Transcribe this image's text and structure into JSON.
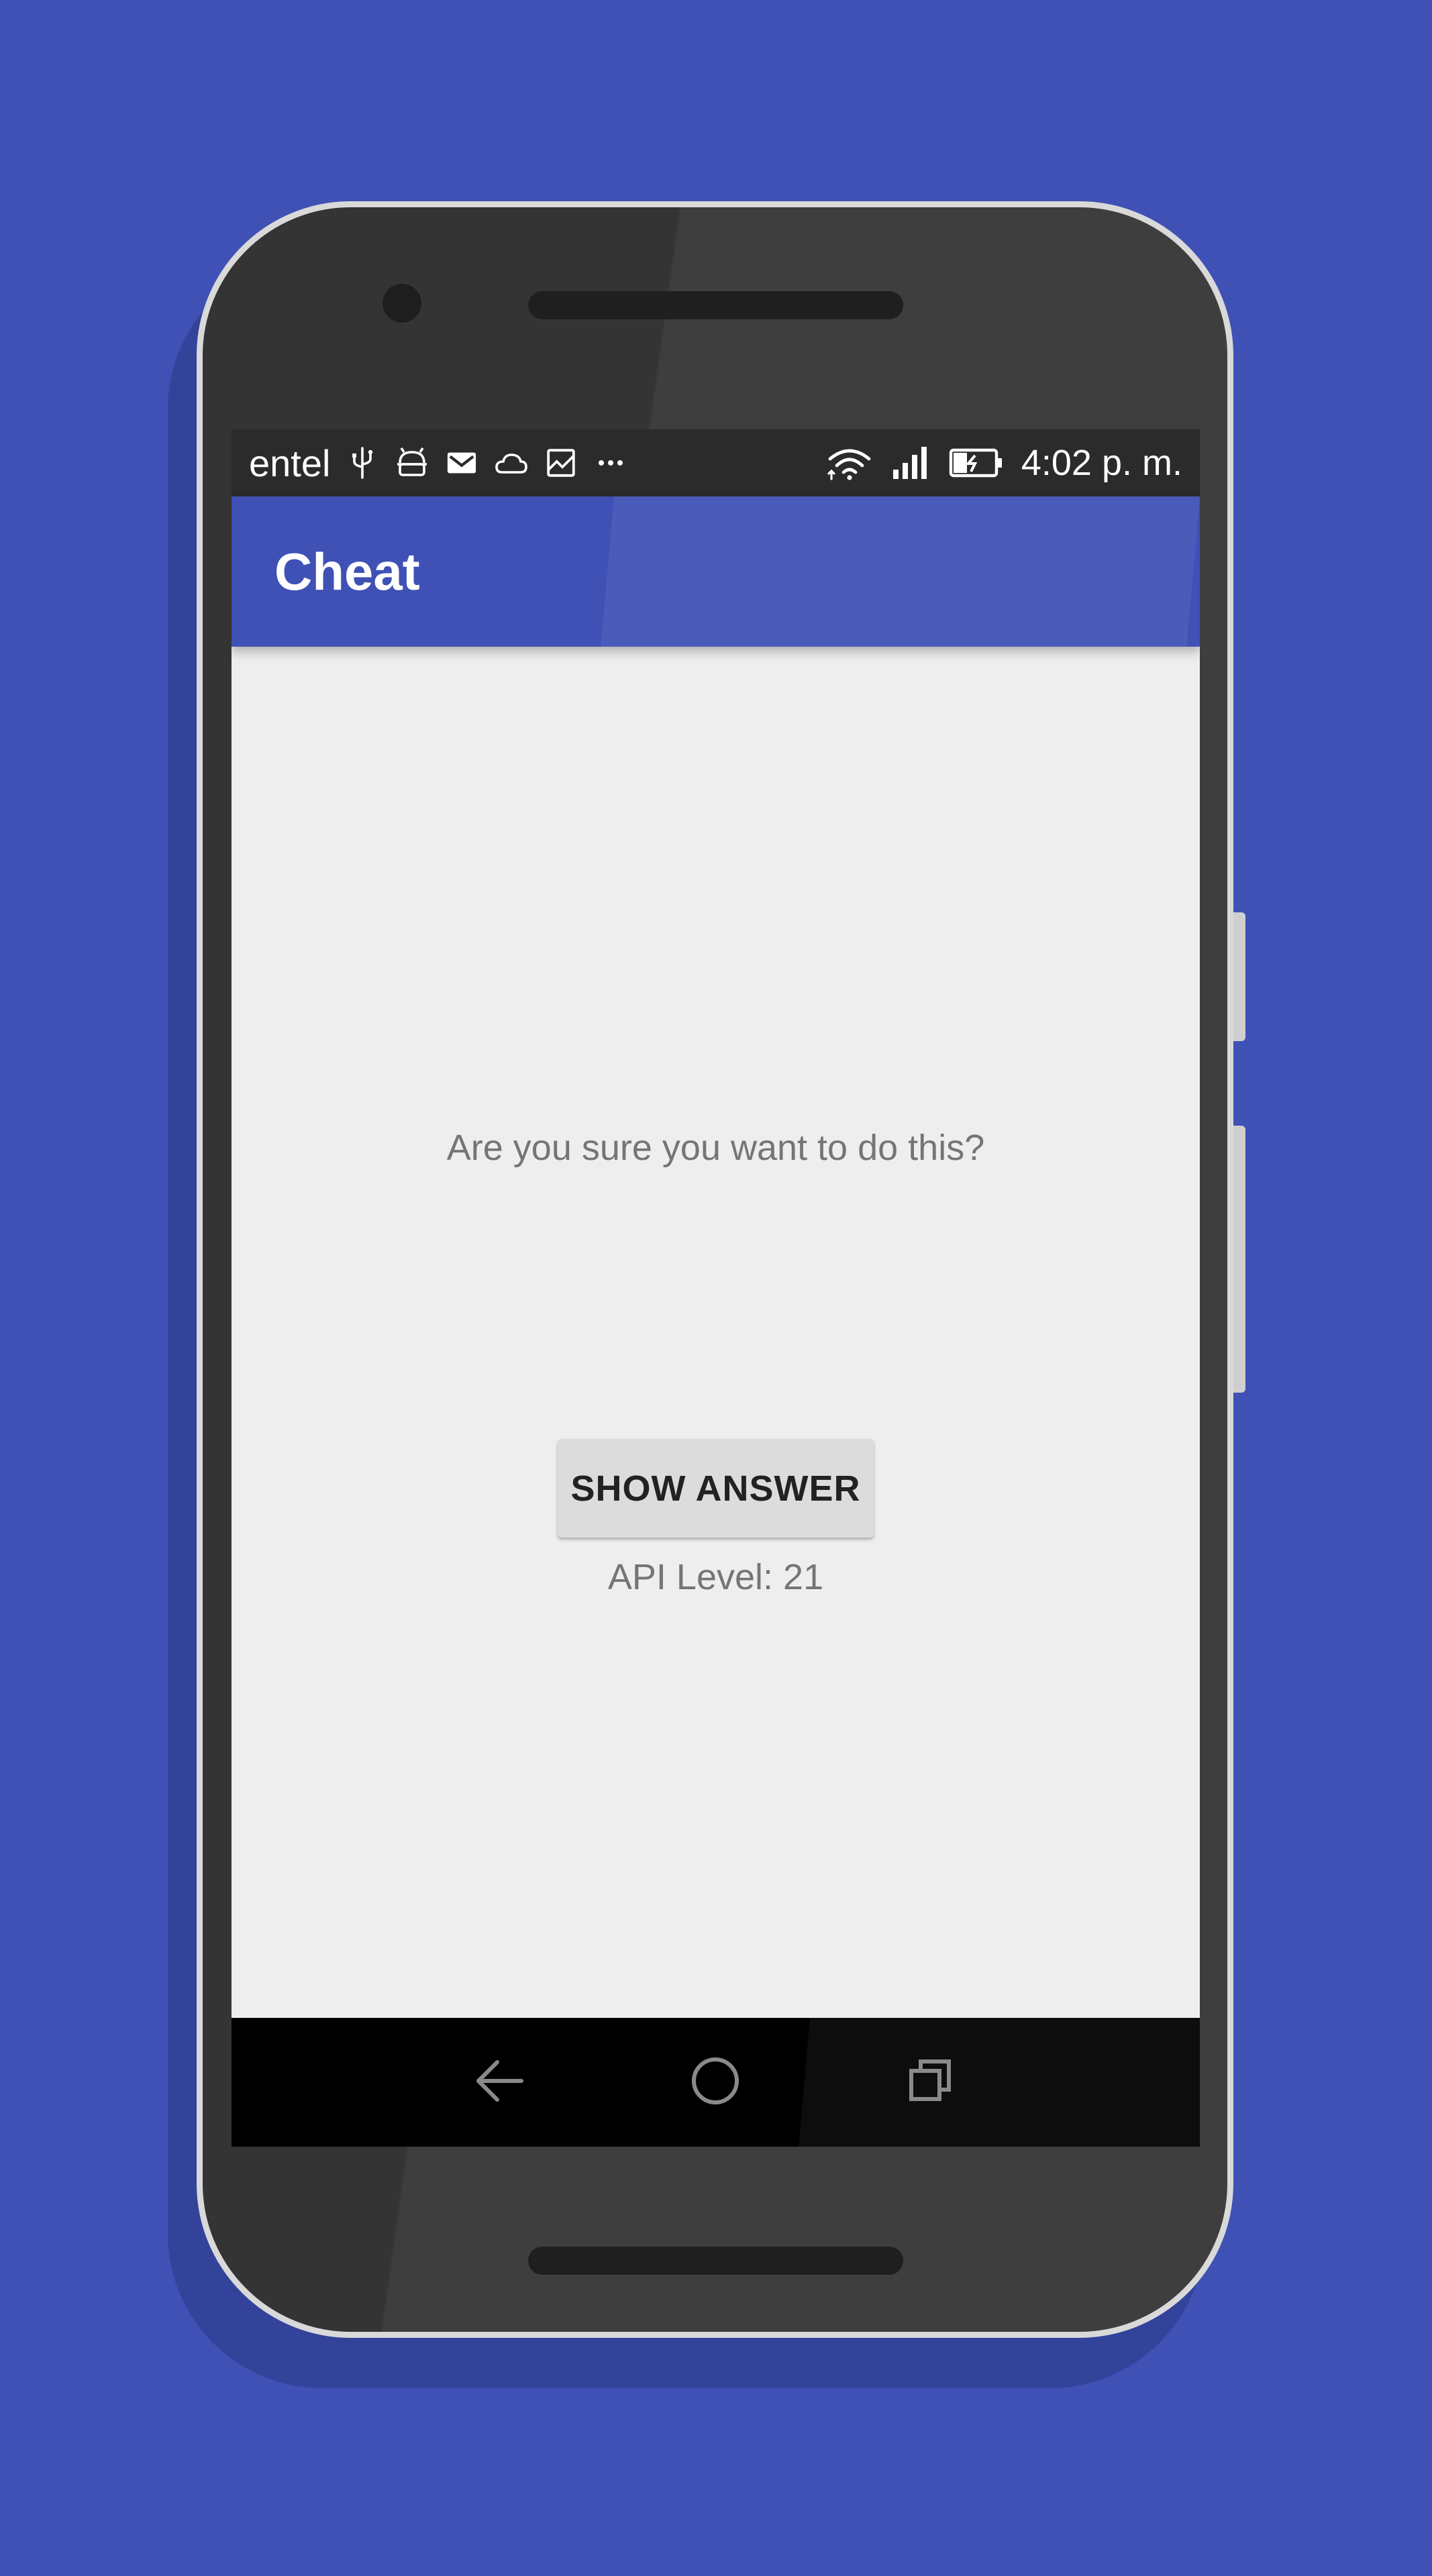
{
  "status_bar": {
    "carrier": "entel",
    "time": "4:02 p. m.",
    "left_icons": [
      "usb-icon",
      "android-debug-icon",
      "gmail-icon",
      "cloud-icon",
      "image-icon",
      "more-notifications-icon"
    ],
    "right_icons": [
      "wifi-icon",
      "signal-icon",
      "battery-charging-icon"
    ]
  },
  "app_bar": {
    "title": "Cheat",
    "color": "#3f51b5"
  },
  "main": {
    "prompt": "Are you sure you want to do this?",
    "show_answer_label": "SHOW ANSWER",
    "api_level": "API Level: 21"
  },
  "nav_bar": {
    "buttons": [
      "back-icon",
      "home-icon",
      "recents-icon"
    ]
  },
  "colors": {
    "background": "#3f51b5",
    "screen": "#eeeeee",
    "secondary_text": "#757575",
    "button": "#dcdcdc"
  }
}
